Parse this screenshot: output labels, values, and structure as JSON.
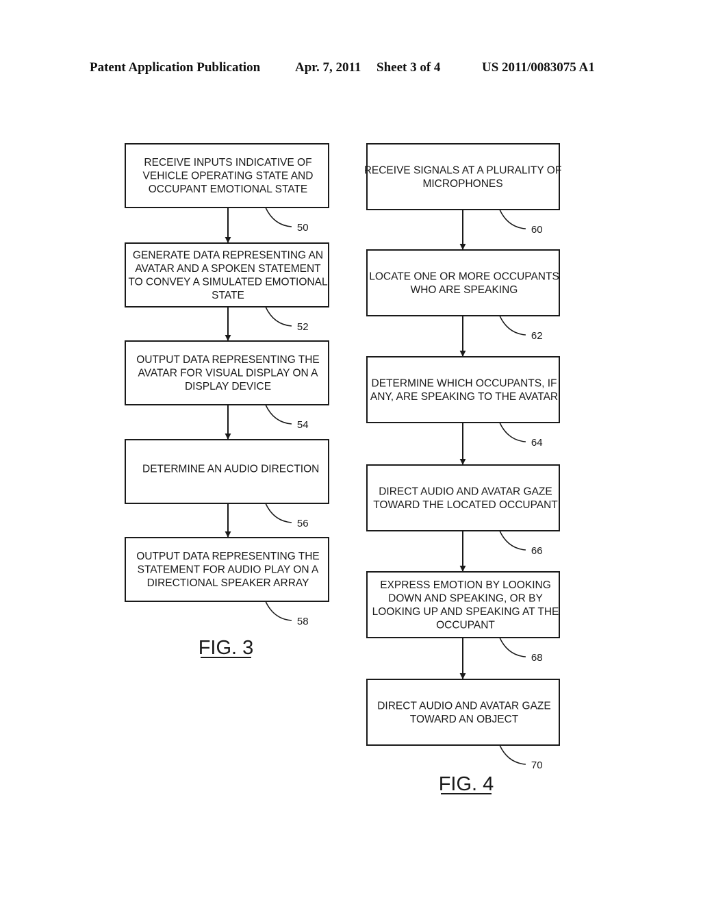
{
  "header": {
    "publication": "Patent Application Publication",
    "date": "Apr. 7, 2011",
    "sheet": "Sheet 3 of 4",
    "number": "US 2011/0083075 A1"
  },
  "figures": [
    {
      "label": "FIG. 3",
      "steps": [
        {
          "ref": "50",
          "lines": [
            "RECEIVE INPUTS INDICATIVE OF",
            "VEHICLE OPERATING STATE AND",
            "OCCUPANT EMOTIONAL STATE"
          ]
        },
        {
          "ref": "52",
          "lines": [
            "GENERATE DATA REPRESENTING AN",
            "AVATAR AND A SPOKEN STATEMENT",
            "TO CONVEY A SIMULATED EMOTIONAL",
            "STATE"
          ]
        },
        {
          "ref": "54",
          "lines": [
            "OUTPUT DATA REPRESENTING THE",
            "AVATAR FOR VISUAL DISPLAY ON A",
            "DISPLAY DEVICE"
          ]
        },
        {
          "ref": "56",
          "lines": [
            "DETERMINE AN AUDIO DIRECTION"
          ]
        },
        {
          "ref": "58",
          "lines": [
            "OUTPUT DATA REPRESENTING THE",
            "STATEMENT FOR AUDIO PLAY ON A",
            "DIRECTIONAL SPEAKER ARRAY"
          ]
        }
      ]
    },
    {
      "label": "FIG. 4",
      "steps": [
        {
          "ref": "60",
          "lines": [
            "RECEIVE SIGNALS AT A PLURALITY OF",
            "MICROPHONES"
          ]
        },
        {
          "ref": "62",
          "lines": [
            "LOCATE ONE OR MORE OCCUPANTS",
            "WHO ARE SPEAKING"
          ]
        },
        {
          "ref": "64",
          "lines": [
            "DETERMINE WHICH OCCUPANTS, IF",
            "ANY, ARE SPEAKING TO THE AVATAR"
          ]
        },
        {
          "ref": "66",
          "lines": [
            "DIRECT AUDIO AND AVATAR GAZE",
            "TOWARD THE LOCATED OCCUPANT"
          ]
        },
        {
          "ref": "68",
          "lines": [
            "EXPRESS EMOTION BY LOOKING",
            "DOWN AND SPEAKING, OR BY",
            "LOOKING UP AND SPEAKING AT THE",
            "OCCUPANT"
          ]
        },
        {
          "ref": "70",
          "lines": [
            "DIRECT AUDIO AND AVATAR GAZE",
            "TOWARD AN OBJECT"
          ]
        }
      ]
    }
  ]
}
